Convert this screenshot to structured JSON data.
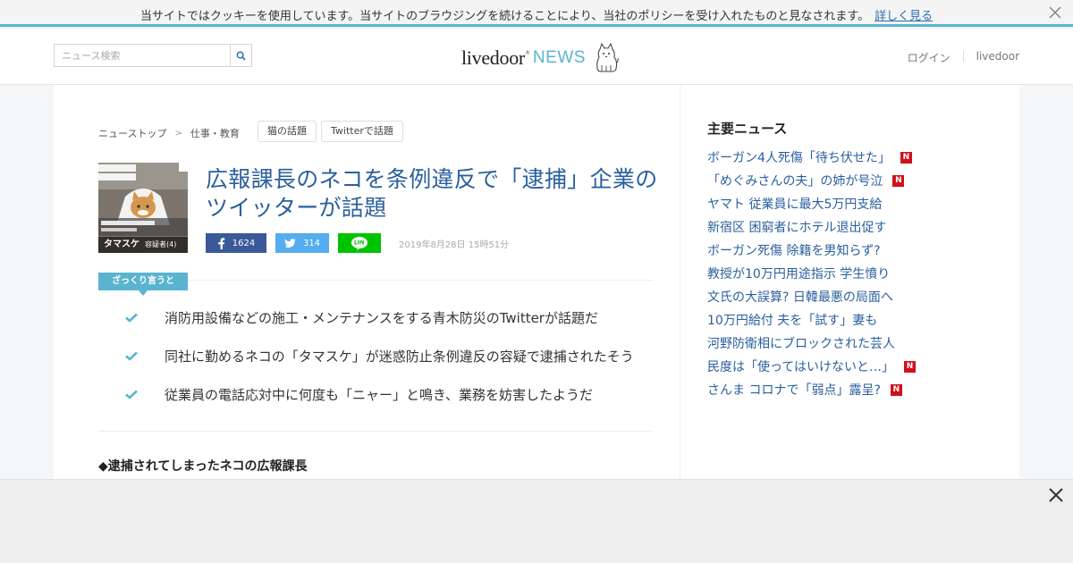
{
  "cookie_bar": {
    "text": "当サイトではクッキーを使用しています。当サイトのブラウジングを続けることにより、当社のポリシーを受け入れたものと見なされます。",
    "link": "詳しく見る"
  },
  "header": {
    "search_placeholder": "ニュース検索",
    "logo_word": "livedoor",
    "logo_reg": "®",
    "logo_news": "NEWS",
    "nav": [
      "ログイン",
      "livedoor"
    ]
  },
  "article": {
    "breadcrumb": [
      "ニューストップ",
      "仕事・教育"
    ],
    "breadcrumb_sep": ">",
    "tags": [
      "猫の話題",
      "Twitterで話題"
    ],
    "thumb_caption": "タマスケ",
    "thumb_caption_sub": "容疑者(4)",
    "title": "広報課長のネコを条例違反で「逮捕」企業のツイッターが話題",
    "share": {
      "facebook_count": "1624",
      "twitter_count": "314"
    },
    "date": "2019年8月28日 15時51分",
    "summary_label": "ざっくり言うと",
    "summary": [
      "消防用設備などの施工・メンテナンスをする青木防災のTwitterが話題だ",
      "同社に勤めるネコの「タマスケ」が迷惑防止条例違反の容疑で逮捕されたそう",
      "従業員の電話応対中に何度も「ニャー」と鳴き、業務を妨害したようだ"
    ],
    "subheading": "◆逮捕されてしまったネコの広報課長"
  },
  "sidebar": {
    "title": "主要ニュース",
    "badge_text": "N",
    "news": [
      {
        "label": "ボーガン4人死傷「待ち伏せた」",
        "new": true
      },
      {
        "label": "「めぐみさんの夫」の姉が号泣",
        "new": true
      },
      {
        "label": "ヤマト 従業員に最大5万円支給",
        "new": false
      },
      {
        "label": "新宿区 困窮者にホテル退出促す",
        "new": false
      },
      {
        "label": "ボーガン死傷 除籍を男知らず?",
        "new": false
      },
      {
        "label": "教授が10万円用途指示 学生憤り",
        "new": false
      },
      {
        "label": "文氏の大誤算? 日韓最悪の局面へ",
        "new": false
      },
      {
        "label": "10万円給付 夫を「試す」妻も",
        "new": false
      },
      {
        "label": "河野防衛相にブロックされた芸人",
        "new": false
      },
      {
        "label": "民度は「使ってはいけないと…」",
        "new": true
      },
      {
        "label": "さんま コロナで「弱点」露呈?",
        "new": true
      }
    ]
  },
  "colors": {
    "accent": "#5ab4cf",
    "link": "#2a5f9e",
    "new_badge": "#d0111b",
    "facebook": "#3b5998",
    "twitter": "#55acee",
    "line": "#00c300"
  }
}
